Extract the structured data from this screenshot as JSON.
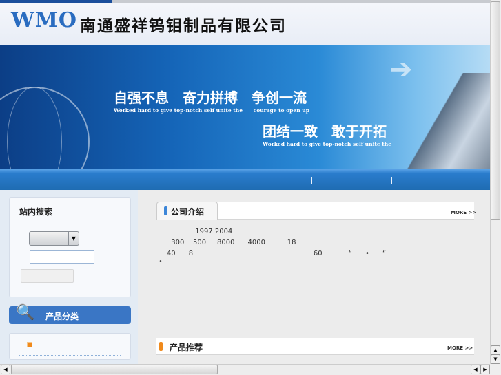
{
  "header": {
    "logo": "WMO",
    "company_name": "南通盛祥钨钼制品有限公司"
  },
  "banner": {
    "slogan1": "自强不息　奋力拼搏　争创一流",
    "sub1": "Worked hard to give top-notch self unite the      courage to open up",
    "slogan2": "团结一致　敢于开拓",
    "sub2": "Worked hard to give top-notch self unite the"
  },
  "sidebar": {
    "search_title": "站内搜索",
    "category_title": "产品分类"
  },
  "main": {
    "intro_title": "公司介绍",
    "intro_more": "MORE >>",
    "intro_lines": [
      "                  1997 2004",
      "       300    500     8000      4000          18",
      "     40      8                                                       60            “      •      “",
      "•"
    ],
    "recommend_title": "产品推荐",
    "recommend_more": "MORE >>"
  },
  "colors": {
    "nav": "#1f6cb2",
    "accent": "#3a76c5"
  }
}
